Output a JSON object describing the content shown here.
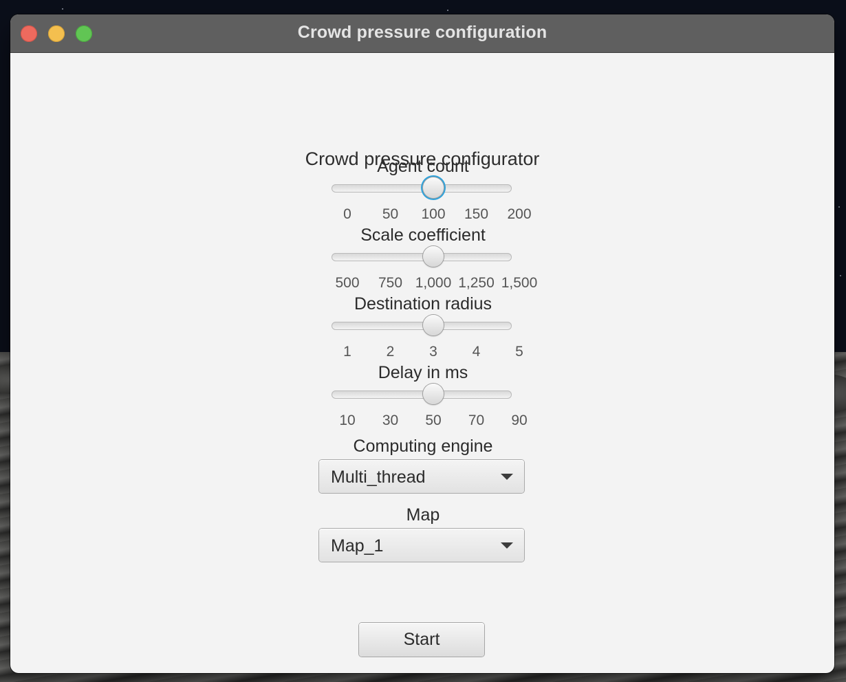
{
  "window": {
    "title": "Crowd pressure configuration"
  },
  "form": {
    "heading": "Crowd pressure configurator",
    "sliders": [
      {
        "label": "Agent count",
        "ticks": [
          "0",
          "50",
          "100",
          "150",
          "200"
        ],
        "min": 0,
        "max": 200,
        "value": 100,
        "focused": true
      },
      {
        "label": "Scale coefficient",
        "ticks": [
          "500",
          "750",
          "1,000",
          "1,250",
          "1,500"
        ],
        "min": 500,
        "max": 1500,
        "value": 1000,
        "focused": false
      },
      {
        "label": "Destination radius",
        "ticks": [
          "1",
          "2",
          "3",
          "4",
          "5"
        ],
        "min": 1,
        "max": 5,
        "value": 3,
        "focused": false
      },
      {
        "label": "Delay in ms",
        "ticks": [
          "10",
          "30",
          "50",
          "70",
          "90"
        ],
        "min": 10,
        "max": 90,
        "value": 50,
        "focused": false
      }
    ],
    "computing_engine": {
      "label": "Computing engine",
      "value": "Multi_thread"
    },
    "map": {
      "label": "Map",
      "value": "Map_1"
    },
    "start_label": "Start"
  },
  "colors": {
    "focus_ring": "#2fa3dc",
    "titlebar": "#5f5f5f",
    "window_bg": "#f3f3f3"
  }
}
